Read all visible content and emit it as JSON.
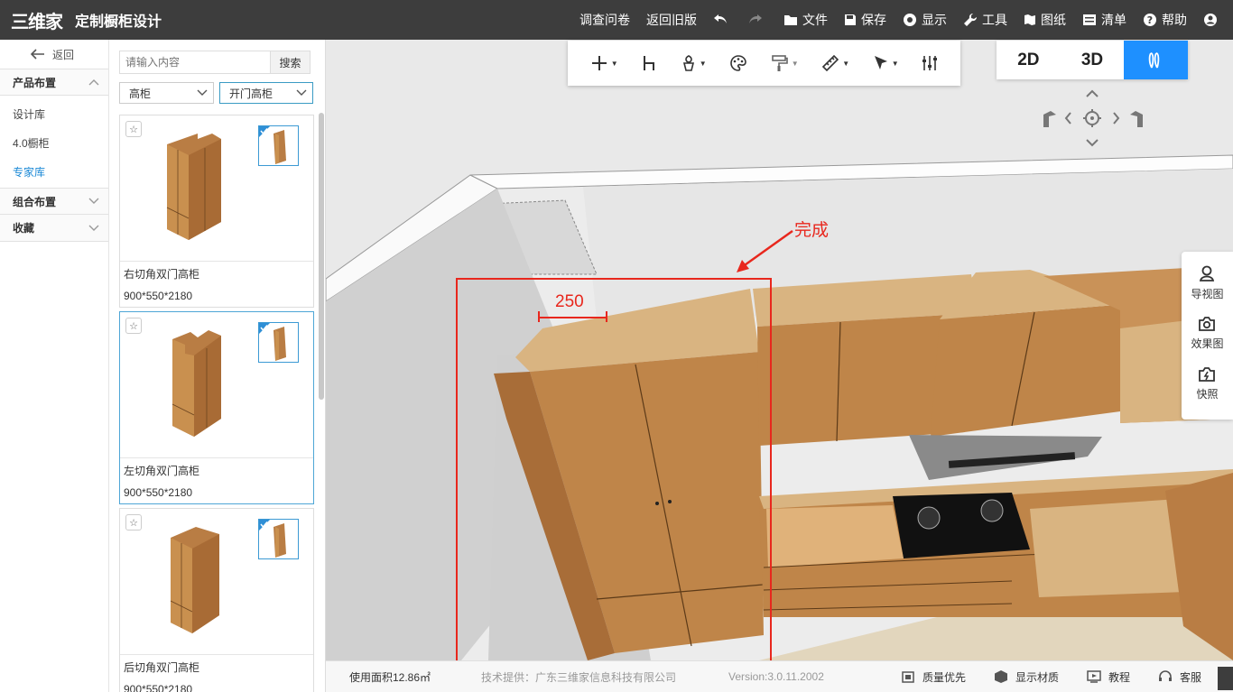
{
  "app": {
    "logo_text": "三维家",
    "title": "定制橱柜设计"
  },
  "topmenu": [
    {
      "label": "调查问卷",
      "icon": ""
    },
    {
      "label": "返回旧版",
      "icon": ""
    },
    {
      "label": "",
      "icon": "undo-icon"
    },
    {
      "label": "",
      "icon": "redo-icon"
    },
    {
      "label": "文件",
      "icon": "folder-icon"
    },
    {
      "label": "保存",
      "icon": "save-icon"
    },
    {
      "label": "显示",
      "icon": "eye-icon"
    },
    {
      "label": "工具",
      "icon": "wrench-icon"
    },
    {
      "label": "图纸",
      "icon": "map-icon"
    },
    {
      "label": "清单",
      "icon": "list-icon"
    },
    {
      "label": "帮助",
      "icon": "help-icon"
    },
    {
      "label": "",
      "icon": "user-icon"
    }
  ],
  "leftnav": {
    "back_label": "返回",
    "sections": [
      {
        "label": "产品布置",
        "expanded": true,
        "items": [
          {
            "label": "设计库",
            "active": false
          },
          {
            "label": "4.0橱柜",
            "active": false
          },
          {
            "label": "专家库",
            "active": true
          }
        ]
      },
      {
        "label": "组合布置",
        "expanded": false,
        "items": []
      },
      {
        "label": "收藏",
        "expanded": false,
        "items": []
      }
    ]
  },
  "catalog": {
    "search_placeholder": "请输入内容",
    "search_button": "搜索",
    "filter1": "高柜",
    "filter2": "开门高柜",
    "products": [
      {
        "name": "右切角双门高柜",
        "size": "900*550*2180",
        "selected": false
      },
      {
        "name": "左切角双门高柜",
        "size": "900*550*2180",
        "selected": true
      },
      {
        "name": "后切角双门高柜",
        "size": "900*550*2180",
        "selected": false
      }
    ]
  },
  "toolbar": {
    "icons": [
      "add-icon",
      "chair-icon",
      "plant-icon",
      "palette-icon",
      "paint-roller-icon",
      "ruler-icon",
      "pointer-icon",
      "sliders-icon"
    ]
  },
  "view_switch": [
    {
      "label": "2D",
      "active": false
    },
    {
      "label": "3D",
      "active": false
    },
    {
      "label": "",
      "icon": "walk-icon",
      "active": true
    }
  ],
  "right_panel": [
    {
      "label": "导视图",
      "icon": "person-icon"
    },
    {
      "label": "效果图",
      "icon": "camera-icon"
    },
    {
      "label": "快照",
      "icon": "snapshot-icon"
    }
  ],
  "annotation": {
    "text": "完成",
    "dimension": "250"
  },
  "status": {
    "area": "使用面积12.86㎡",
    "provider": "技术提供：广东三维家信息科技有限公司",
    "version": "Version:3.0.11.2002",
    "quality": "质量优先",
    "material": "显示材质",
    "tutorial": "教程",
    "service": "客服"
  },
  "colors": {
    "topbar": "#3d3d3d",
    "accent": "#1e90ff",
    "annotation": "#e8271d",
    "wood": "#c58a4f"
  }
}
